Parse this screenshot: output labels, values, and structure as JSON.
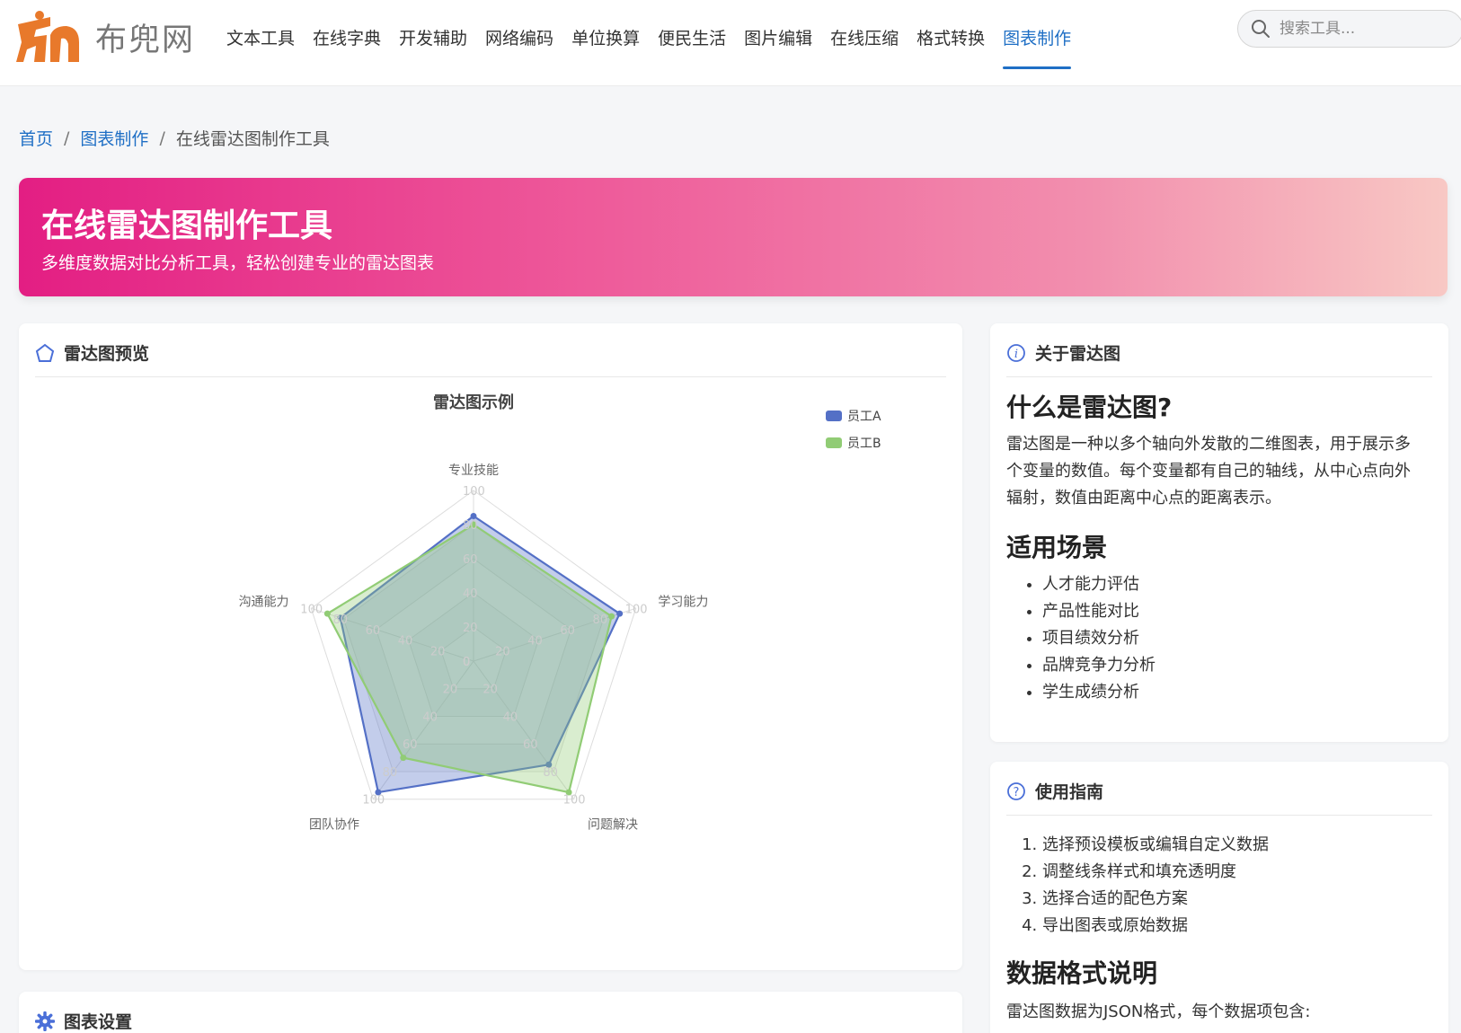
{
  "header": {
    "logo_text": "布兜网",
    "nav": [
      "文本工具",
      "在线字典",
      "开发辅助",
      "网络编码",
      "单位换算",
      "便民生活",
      "图片编辑",
      "在线压缩",
      "格式转换",
      "图表制作"
    ],
    "active_nav": "图表制作",
    "search_placeholder": "搜索工具..."
  },
  "breadcrumb": {
    "home": "首页",
    "category": "图表制作",
    "current": "在线雷达图制作工具"
  },
  "hero": {
    "title": "在线雷达图制作工具",
    "subtitle": "多维度数据对比分析工具，轻松创建专业的雷达图表"
  },
  "chart_card": {
    "title": "雷达图预览"
  },
  "chart_data": {
    "type": "radar",
    "title": "雷达图示例",
    "indicators": [
      "专业技能",
      "学习能力",
      "问题解决",
      "团队协作",
      "沟通能力"
    ],
    "max": 100,
    "tick_values": [
      0,
      20,
      40,
      60,
      80,
      100
    ],
    "series": [
      {
        "name": "员工A",
        "values": [
          85,
          90,
          75,
          95,
          82
        ],
        "color": "#5470c6"
      },
      {
        "name": "员工B",
        "values": [
          80,
          85,
          95,
          70,
          90
        ],
        "color": "#91cc75"
      }
    ],
    "legend_position": "top-right"
  },
  "about": {
    "title": "关于雷达图",
    "h_what": "什么是雷达图?",
    "desc": "雷达图是一种以多个轴向外发散的二维图表，用于展示多个变量的数值。每个变量都有自己的轴线，从中心点向外辐射，数值由距离中心点的距离表示。",
    "h_use": "适用场景",
    "uses": [
      "人才能力评估",
      "产品性能对比",
      "项目绩效分析",
      "品牌竞争力分析",
      "学生成绩分析"
    ]
  },
  "guide": {
    "title": "使用指南",
    "steps": [
      "选择预设模板或编辑自定义数据",
      "调整线条样式和填充透明度",
      "选择合适的配色方案",
      "导出图表或原始数据"
    ],
    "h_format": "数据格式说明",
    "format_desc": "雷达图数据为JSON格式，每个数据项包含:"
  },
  "settings": {
    "title": "图表设置"
  }
}
